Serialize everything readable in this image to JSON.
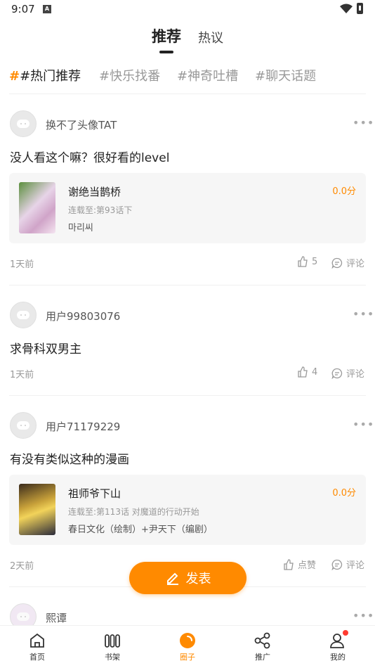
{
  "status_bar": {
    "time": "9:07",
    "notification_icon": "a-icon"
  },
  "header": {
    "tabs": [
      {
        "label": "推荐",
        "active": true
      },
      {
        "label": "热议",
        "active": false
      }
    ]
  },
  "topics": [
    {
      "hash": "#",
      "label": "#热门推荐",
      "active": true
    },
    {
      "label": "#快乐找番",
      "active": false
    },
    {
      "label": "#神奇吐槽",
      "active": false
    },
    {
      "label": "#聊天话题",
      "active": false
    }
  ],
  "posts": [
    {
      "user": "换不了头像TAT",
      "text": "没人看这个嘛？很好看的level",
      "card": {
        "title": "谢绝当鹊桥",
        "progress": "连载至:第93话下",
        "author": "마리씨",
        "score": "0.0分"
      },
      "time": "1天前",
      "likes": "5",
      "comment_label": "评论"
    },
    {
      "user": "用户99803076",
      "text": "求骨科双男主",
      "time": "1天前",
      "likes": "4",
      "comment_label": "评论"
    },
    {
      "user": "用户71179229",
      "text": "有没有类似这种的漫画",
      "card": {
        "title": "祖师爷下山",
        "progress": "连载至:第113话 对魔道的行动开始",
        "author": "春日文化（绘制）+尹天下（编剧）",
        "score": "0.0分"
      },
      "time": "2天前",
      "likes": "点赞",
      "comment_label": "评论"
    },
    {
      "user": "熙谭"
    }
  ],
  "fab": {
    "label": "发表"
  },
  "bottom_nav": [
    {
      "label": "首页",
      "icon": "home-icon"
    },
    {
      "label": "书架",
      "icon": "bookshelf-icon"
    },
    {
      "label": "圈子",
      "icon": "circle-icon",
      "active": true
    },
    {
      "label": "推广",
      "icon": "share-icon"
    },
    {
      "label": "我的",
      "icon": "profile-icon",
      "badge": true
    }
  ],
  "colors": {
    "accent": "#ff8a00",
    "badge": "#ff3b30"
  }
}
